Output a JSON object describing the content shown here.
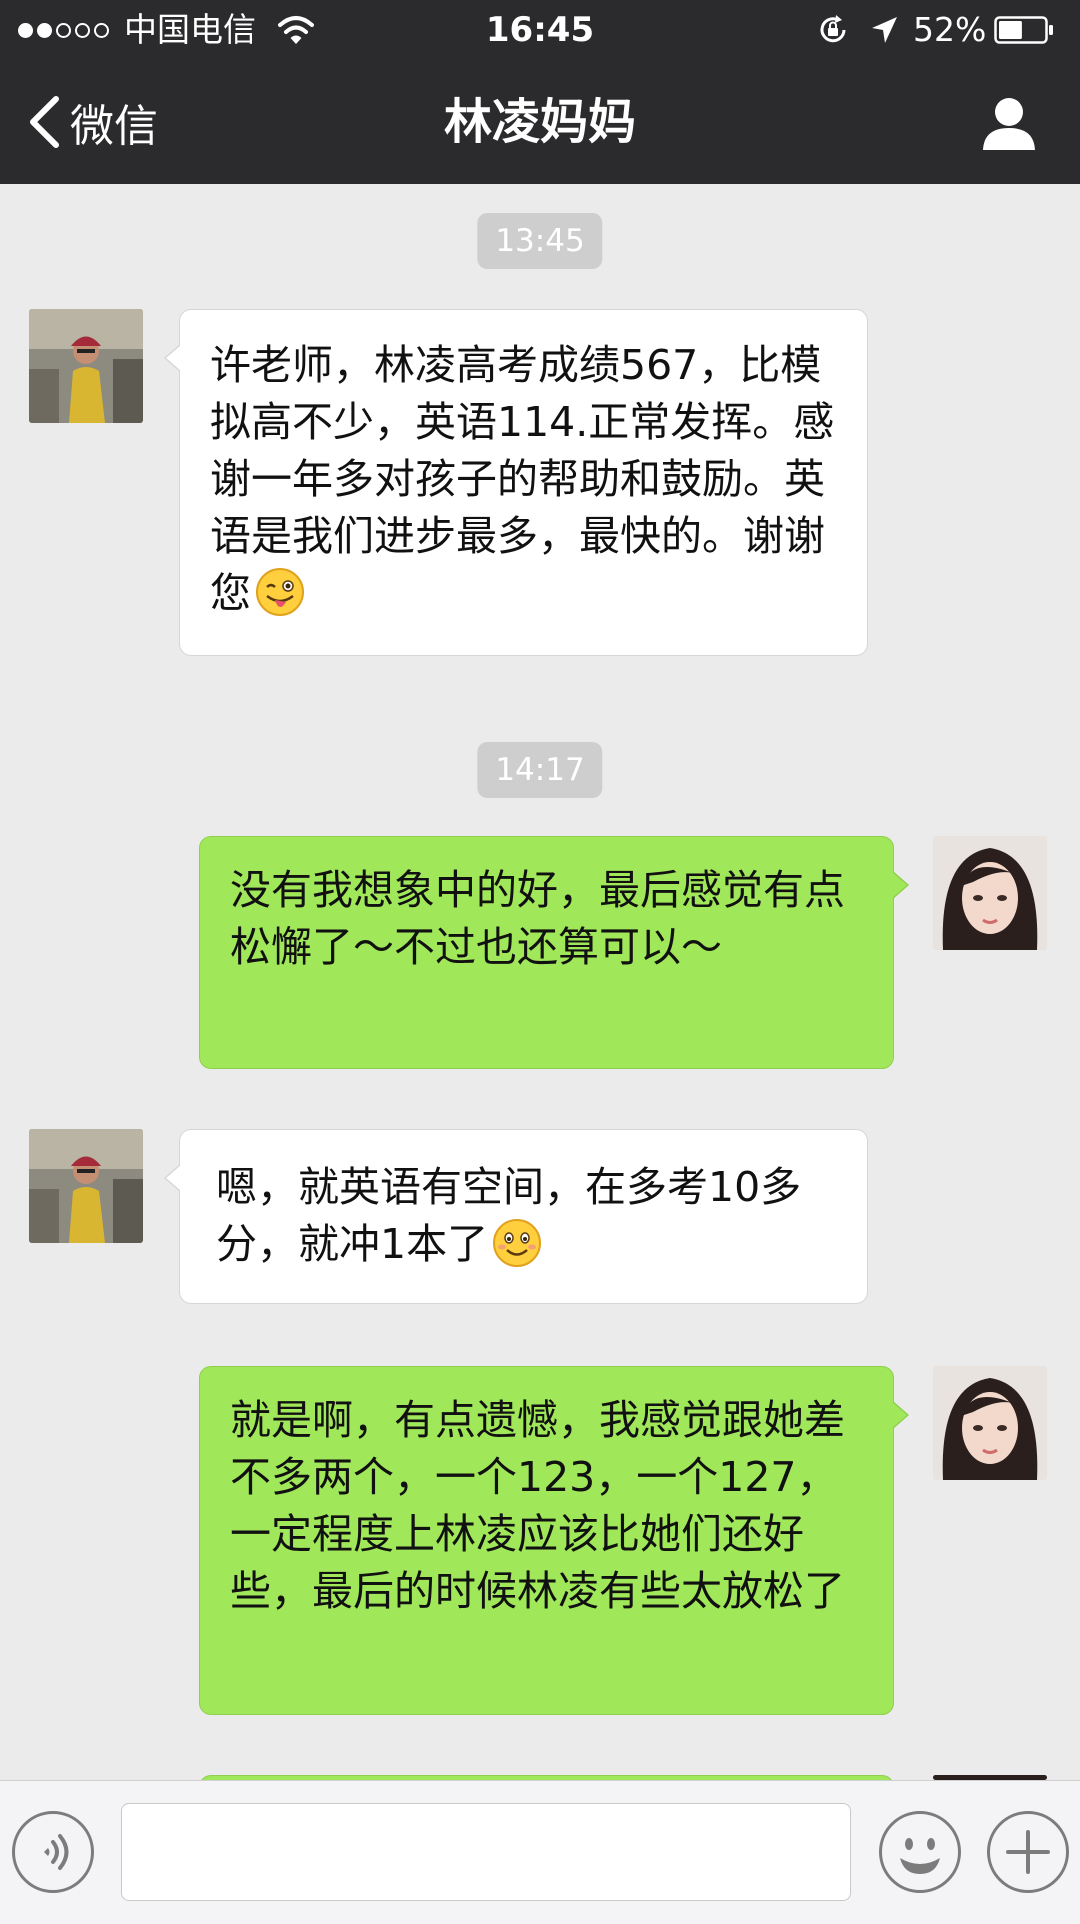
{
  "status_bar": {
    "signal_filled": 2,
    "signal_total": 5,
    "carrier": "中国电信",
    "time": "16:45",
    "battery": "52%",
    "battery_level": 0.52
  },
  "nav": {
    "back_label": "微信",
    "title": "林凌妈妈"
  },
  "messages": [
    {
      "kind": "timestamp",
      "text": "13:45"
    },
    {
      "kind": "incoming",
      "text": "许老师，林凌高考成绩567，比模拟高不少，英语114.正常发挥。感谢一年多对孩子的帮助和鼓励。英语是我们进步最多，最快的。谢谢您",
      "emoji": "winking-tongue-emoji"
    },
    {
      "kind": "timestamp",
      "text": "14:17"
    },
    {
      "kind": "outgoing",
      "text": "没有我想象中的好，最后感觉有点松懈了～不过也还算可以～"
    },
    {
      "kind": "incoming",
      "text": "嗯，就英语有空间，在多考10多分，就冲1本了",
      "emoji": "smile-emoji"
    },
    {
      "kind": "outgoing",
      "text": "就是啊，有点遗憾，我感觉跟她差不多两个，一个123，一个127，一定程度上林凌应该比她们还好些，最后的时候林凌有些太放松了"
    }
  ],
  "input": {
    "value": "",
    "placeholder": ""
  },
  "colors": {
    "bar_background": "#2b2b2d",
    "chat_background": "#ebebeb",
    "outgoing_bubble": "#a0e75a",
    "incoming_bubble": "#ffffff",
    "timestamp_bg": "#cecece"
  },
  "icons": [
    "wifi-icon",
    "rotation-lock-icon",
    "location-arrow-icon",
    "battery-icon",
    "back-chevron-icon",
    "contact-profile-icon",
    "voice-icon",
    "emoji-icon",
    "plus-icon"
  ]
}
